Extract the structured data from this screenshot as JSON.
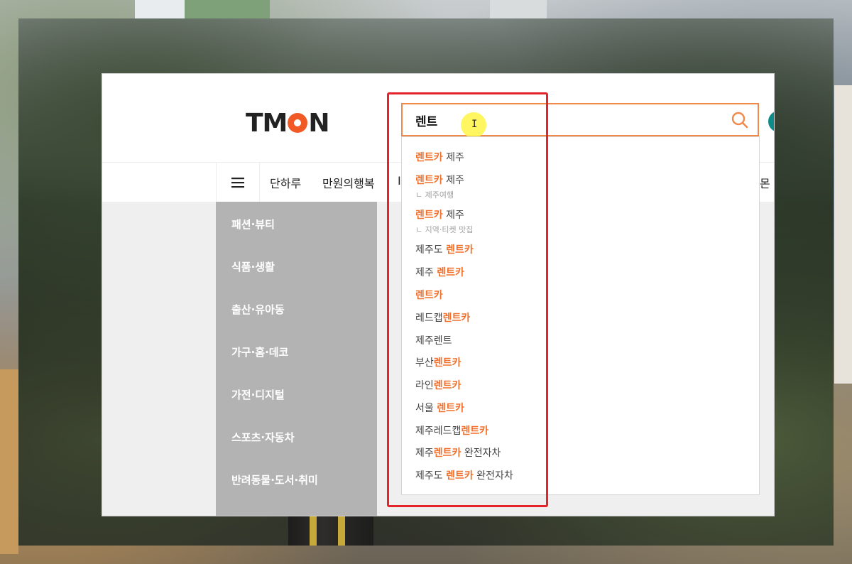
{
  "header": {
    "logo_text": "TMON",
    "search_value": "렌트"
  },
  "nav": {
    "items": [
      "단하루",
      "만원의행복",
      "I",
      "몬"
    ]
  },
  "categories": [
    "패션·뷰티",
    "식품·생활",
    "출산·유아동",
    "가구·홈·데코",
    "가전·디지털",
    "스포츠·자동차",
    "반려동물·도서·취미"
  ],
  "suggestions": [
    {
      "pre": "",
      "hl": "렌트카",
      "post": " 제주",
      "sub": ""
    },
    {
      "pre": "",
      "hl": "렌트카",
      "post": " 제주",
      "sub": "ㄴ 제주여행"
    },
    {
      "pre": "",
      "hl": "렌트카",
      "post": " 제주",
      "sub": "ㄴ 지역·티켓 맛집"
    },
    {
      "pre": "제주도 ",
      "hl": "렌트카",
      "post": "",
      "sub": ""
    },
    {
      "pre": "제주 ",
      "hl": "렌트카",
      "post": "",
      "sub": ""
    },
    {
      "pre": "",
      "hl": "렌트카",
      "post": "",
      "sub": ""
    },
    {
      "pre": "레드캡",
      "hl": "렌트카",
      "post": "",
      "sub": ""
    },
    {
      "pre": "제주렌트",
      "hl": "",
      "post": "",
      "sub": ""
    },
    {
      "pre": "부산",
      "hl": "렌트카",
      "post": "",
      "sub": ""
    },
    {
      "pre": "라인",
      "hl": "렌트카",
      "post": "",
      "sub": ""
    },
    {
      "pre": "서울 ",
      "hl": "렌트카",
      "post": "",
      "sub": ""
    },
    {
      "pre": "제주레드캡",
      "hl": "렌트카",
      "post": "",
      "sub": ""
    },
    {
      "pre": "제주",
      "hl": "렌트카",
      "post": " 완전자차",
      "sub": ""
    },
    {
      "pre": "제주도 ",
      "hl": "렌트카",
      "post": " 완전자차",
      "sub": ""
    }
  ],
  "colors": {
    "accent": "#f0702d",
    "search_border": "#f08a4b",
    "annotation": "#e3242b",
    "category_panel": "#b3b3b3"
  },
  "icons": {
    "search": "search-icon",
    "menu": "hamburger-menu-icon",
    "cursor": "text-cursor-icon"
  }
}
